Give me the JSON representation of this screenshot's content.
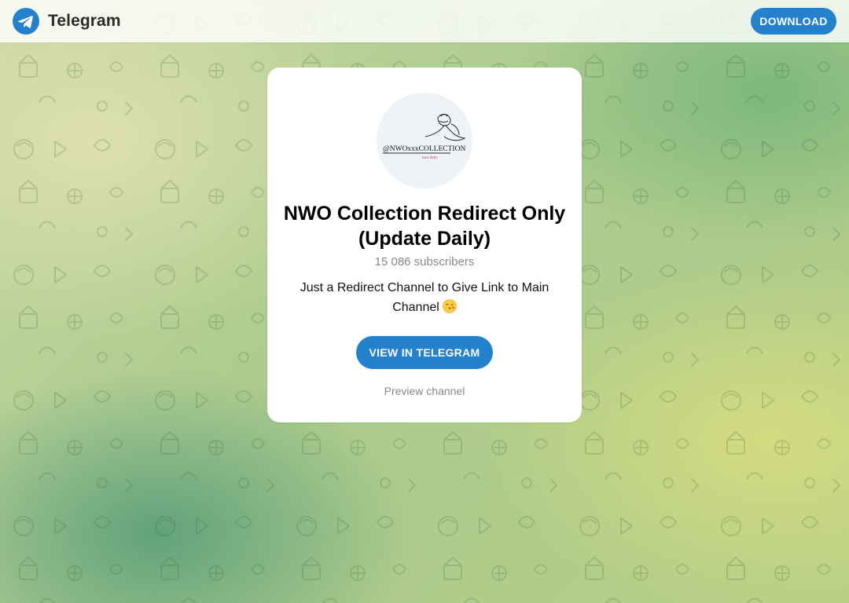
{
  "header": {
    "brand_name": "Telegram",
    "download_label": "DOWNLOAD"
  },
  "channel": {
    "avatar_text": "@NWOxxxCOLLECTION",
    "avatar_subtext": "nwo daily",
    "title": "NWO Collection Redirect Only (Update Daily)",
    "subscribers": "15 086 subscribers",
    "description": "Just a Redirect Channel to Give Link to Main Channel",
    "description_emoji": "kiss-face-emoji",
    "view_button_label": "VIEW IN TELEGRAM",
    "preview_label": "Preview channel"
  },
  "colors": {
    "accent": "#2481cc",
    "muted": "#888888"
  },
  "icons": {
    "brand": "telegram-logo-icon"
  }
}
